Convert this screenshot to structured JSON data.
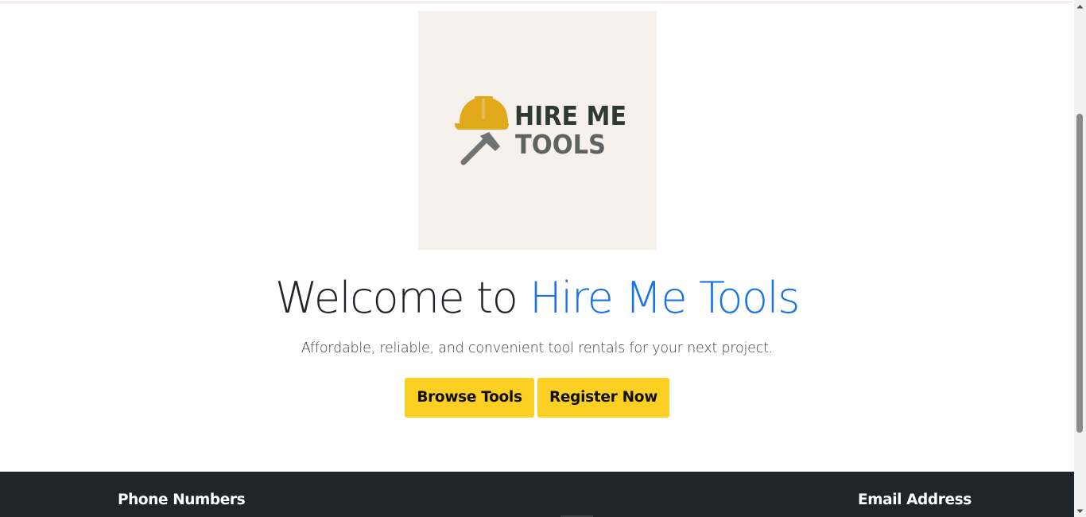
{
  "logo": {
    "line1": "HIRE ME",
    "line2": "TOOLS",
    "icons": [
      "hard-hat-icon",
      "hammer-icon"
    ],
    "colors": {
      "background": "#f6f2eb",
      "hat": "#e2a91d",
      "line1": "#2f3a33",
      "line2": "#5e6360",
      "hammer": "#6f7472"
    }
  },
  "hero": {
    "title_prefix": "Welcome to",
    "title_brand": "Hire Me Tools",
    "tagline": "Affordable, reliable, and convenient tool rentals for your next project.",
    "buttons": {
      "browse": "Browse Tools",
      "register": "Register Now"
    }
  },
  "footer": {
    "phone_heading": "Phone Numbers",
    "email_heading": "Email Address"
  },
  "colors": {
    "accent_blue": "#1a73e8",
    "button_yellow": "#fcd023",
    "footer_bg": "#212529"
  }
}
